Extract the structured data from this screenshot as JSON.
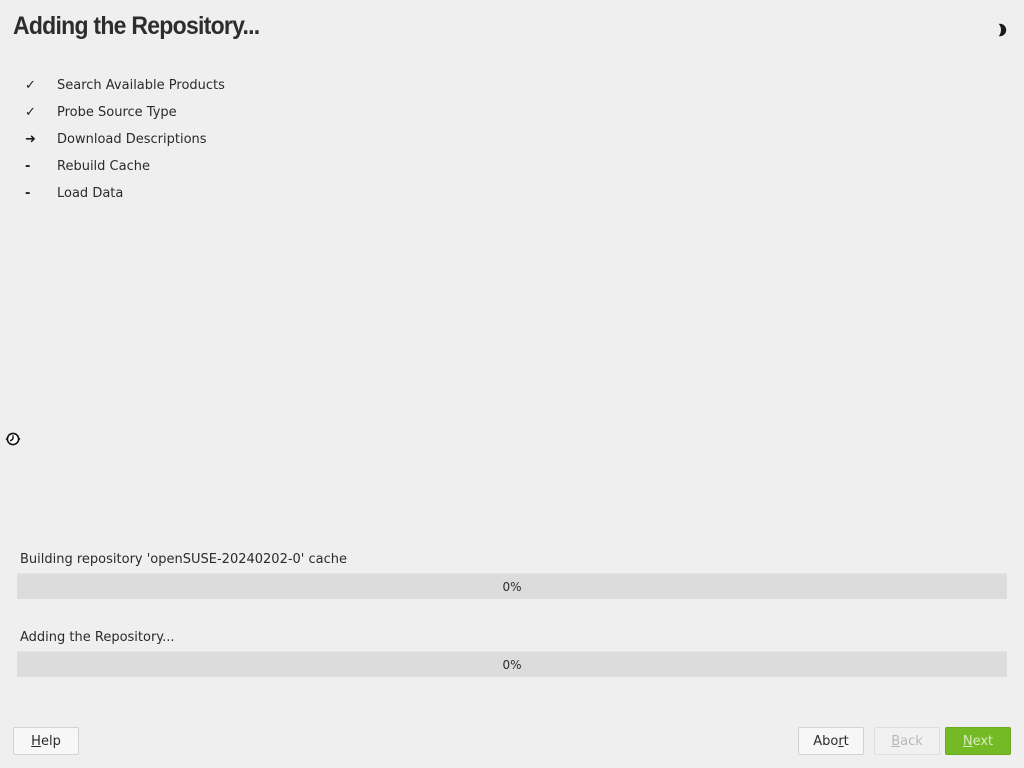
{
  "window": {
    "title": "Adding the Repository..."
  },
  "theme_toggle": {
    "icon": "half-moon-icon"
  },
  "steps": [
    {
      "marker": "✓",
      "label": "Search Available Products",
      "status": "done"
    },
    {
      "marker": "✓",
      "label": "Probe Source Type",
      "status": "done"
    },
    {
      "marker": "➜",
      "label": "Download Descriptions",
      "status": "current"
    },
    {
      "marker": "-",
      "label": "Rebuild Cache",
      "status": "pending"
    },
    {
      "marker": "-",
      "label": "Load Data",
      "status": "pending"
    }
  ],
  "busy_indicator": {
    "icon": "busy-clock-icon"
  },
  "progress": [
    {
      "label": "Building repository 'openSUSE-20240202-0' cache",
      "value": 0,
      "text": "0%"
    },
    {
      "label": "Adding the Repository...",
      "value": 0,
      "text": "0%"
    }
  ],
  "buttons": {
    "help": {
      "pre": "",
      "mnemonic": "H",
      "post": "elp"
    },
    "abort": {
      "pre": "Abo",
      "mnemonic": "r",
      "post": "t"
    },
    "back": {
      "pre": "",
      "mnemonic": "B",
      "post": "ack",
      "enabled": false
    },
    "next": {
      "pre": "",
      "mnemonic": "N",
      "post": "ext",
      "enabled": false
    }
  },
  "colors": {
    "background": "#efefef",
    "accent_green": "#73ba25",
    "progress_track": "#dcdcdc",
    "text": "#2b2b2b"
  }
}
